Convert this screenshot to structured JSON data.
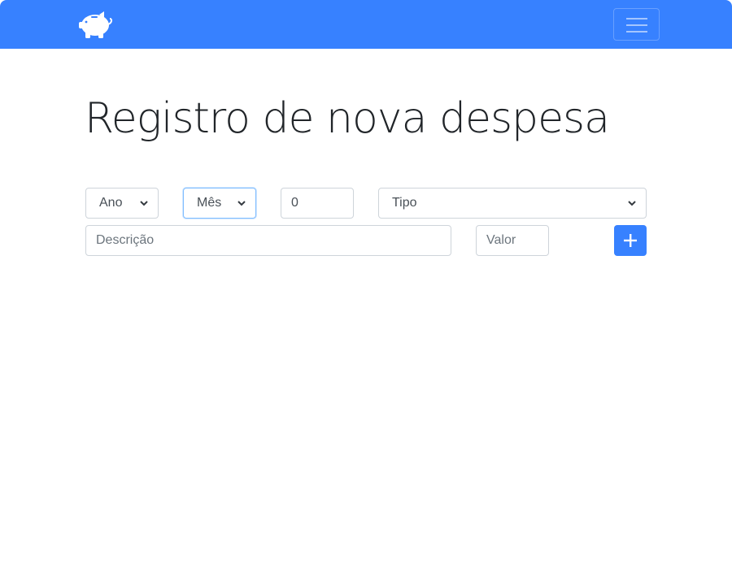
{
  "header": {
    "brand_icon": "piggy-bank-icon",
    "menu_icon": "hamburger-menu-icon",
    "accent_color": "#3781ff"
  },
  "page": {
    "title": "Registro de nova despesa"
  },
  "form": {
    "ano": {
      "selected": "Ano"
    },
    "mes": {
      "selected": "Mês"
    },
    "dia": {
      "value": "0"
    },
    "tipo": {
      "selected": "Tipo"
    },
    "descricao": {
      "placeholder": "Descrição"
    },
    "valor": {
      "placeholder": "Valor"
    },
    "add_button": {
      "icon": "plus-icon"
    }
  }
}
